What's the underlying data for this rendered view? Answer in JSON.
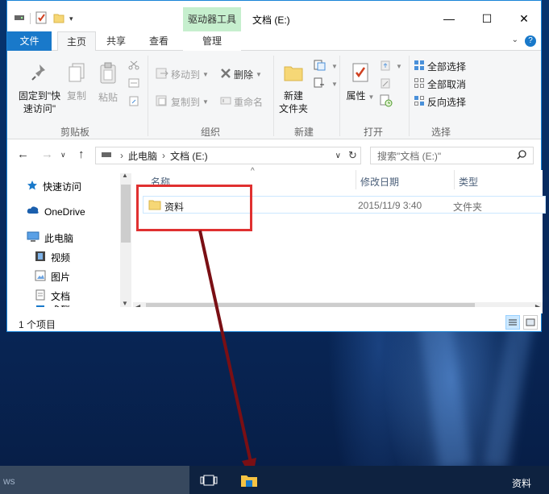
{
  "window": {
    "context_tab": "驱动器工具",
    "title": "文档 (E:)",
    "controls": {
      "minimize": "—",
      "maximize": "☐",
      "close": "✕"
    }
  },
  "tabs": [
    {
      "label": "文件"
    },
    {
      "label": "主页"
    },
    {
      "label": "共享"
    },
    {
      "label": "查看"
    },
    {
      "label": "管理"
    }
  ],
  "ribbon": {
    "clipboard": {
      "label": "剪贴板",
      "pin_line1": "固定到\"快",
      "pin_line2": "速访问\"",
      "copy": "复制",
      "paste": "粘贴"
    },
    "organize": {
      "label": "组织",
      "move_to": "移动到",
      "copy_to": "复制到",
      "delete": "删除",
      "rename": "重命名"
    },
    "new": {
      "label": "新建",
      "new_folder_line1": "新建",
      "new_folder_line2": "文件夹"
    },
    "open": {
      "label": "打开",
      "properties": "属性"
    },
    "select": {
      "label": "选择",
      "select_all": "全部选择",
      "select_none": "全部取消",
      "invert": "反向选择"
    }
  },
  "address": {
    "crumb1": "此电脑",
    "crumb2": "文档 (E:)",
    "search_placeholder": "搜索\"文档 (E:)\""
  },
  "nav": {
    "quick_access": "快速访问",
    "onedrive": "OneDrive",
    "this_pc": "此电脑",
    "videos": "视频",
    "pictures": "图片",
    "documents": "文档",
    "downloads": "下载"
  },
  "columns": {
    "name": "名称",
    "modified": "修改日期",
    "type": "类型"
  },
  "files": [
    {
      "name": "资料",
      "modified": "2015/11/9 3:40",
      "type": "文件夹"
    }
  ],
  "status": {
    "count": "1 个项目"
  },
  "taskbar": {
    "search_text": "ws",
    "pinned_label": "资料"
  },
  "colors": {
    "accent": "#1979ca",
    "highlight_box": "#e03030",
    "arrow": "#7a0f14",
    "context_tab": "#c6efce"
  }
}
